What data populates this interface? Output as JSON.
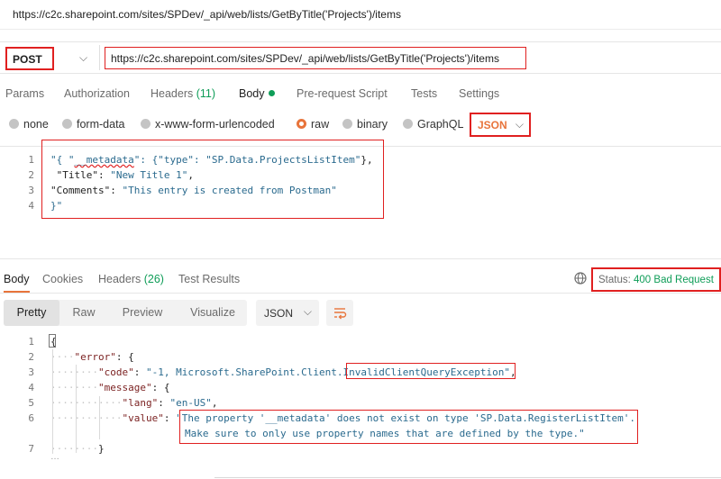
{
  "page_url": "https://c2c.sharepoint.com/sites/SPDev/_api/web/lists/GetByTitle('Projects')/items",
  "request": {
    "method": "POST",
    "url": "https://c2c.sharepoint.com/sites/SPDev/_api/web/lists/GetByTitle('Projects')/items"
  },
  "request_tabs": [
    {
      "label": "Params"
    },
    {
      "label": "Authorization"
    },
    {
      "label": "Headers",
      "count": "(11)"
    },
    {
      "label": "Body"
    },
    {
      "label": "Pre-request Script"
    },
    {
      "label": "Tests"
    },
    {
      "label": "Settings"
    }
  ],
  "body_types": [
    "none",
    "form-data",
    "x-www-form-urlencoded",
    "raw",
    "binary",
    "GraphQL"
  ],
  "body_format": "JSON",
  "request_body": {
    "line_numbers": [
      "1",
      "2",
      "3",
      "4"
    ],
    "l1_a": "\"{ \"",
    "l1_b": "__metadata",
    "l1_c": "\": {\"type\": ",
    "l1_d": "\"SP.Data.ProjectsListItem\"",
    "l1_e": "},",
    "l2_a": " \"Title\": ",
    "l2_b": "\"New Title 1\"",
    "l2_c": ",",
    "l3_a": "\"Comments\": ",
    "l3_b": "\"This entry is created from Postman\"",
    "l4": "}\""
  },
  "response_tabs": [
    {
      "label": "Body"
    },
    {
      "label": "Cookies"
    },
    {
      "label": "Headers",
      "count": "(26)"
    },
    {
      "label": "Test Results"
    }
  ],
  "status": {
    "label": "Status:",
    "value": "400 Bad Request"
  },
  "view_modes": [
    "Pretty",
    "Raw",
    "Preview",
    "Visualize"
  ],
  "response_format": "JSON",
  "response_body": {
    "line_numbers": [
      "1",
      "2",
      "3",
      "4",
      "5",
      "6",
      "7"
    ],
    "l1": "{",
    "l2_key": "\"error\"",
    "l2_rest": ": {",
    "l3_key": "\"code\"",
    "l3_val_a": "\"-1, Microsoft.SharePoint.Client.",
    "l3_val_b": "InvalidClientQueryException",
    "l3_val_c": "\"",
    "l3_rest": ",",
    "l4_key": "\"message\"",
    "l4_rest": ": {",
    "l5_key": "\"lang\"",
    "l5_val": "\"en-US\"",
    "l5_rest": ",",
    "l6_key": "\"value\"",
    "l6_val": "\"The property '__metadata' does not exist on type 'SP.Data.RegisterListItem'.",
    "l6_cont": "Make sure to only use property names that are defined by the type.\"",
    "l7": "}"
  },
  "colors": {
    "highlight": "#e02020",
    "accent": "#e8743b",
    "status_green": "#0f9d58",
    "string_blue": "#2a6a8e",
    "key_maroon": "#7a1f1f"
  }
}
